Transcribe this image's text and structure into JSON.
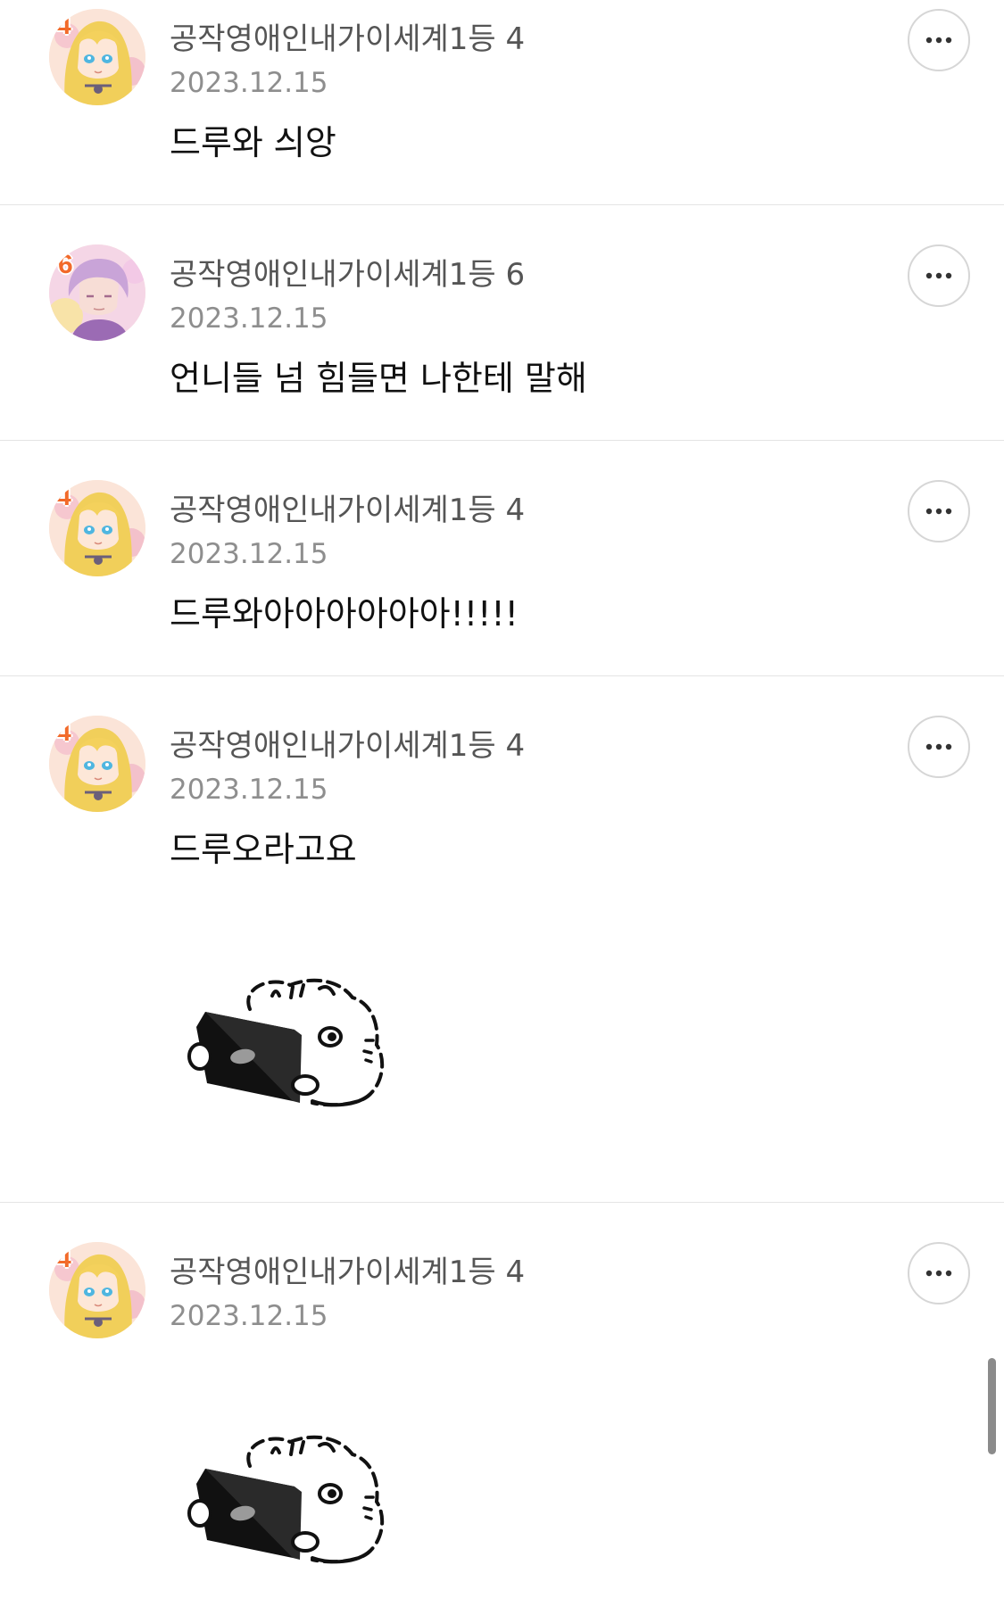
{
  "comments": [
    {
      "author": "공작영애인내가이세계1등 4",
      "avatar_badge": "4",
      "avatar_icon": "blonde-girl-avatar-icon",
      "date": "2023.12.15",
      "text": "드루와 싀앙",
      "more_icon": "more-horizontal-icon"
    },
    {
      "author": "공작영애인내가이세계1등 6",
      "avatar_badge": "6",
      "avatar_icon": "pink-boy-avatar-icon",
      "date": "2023.12.15",
      "text": "언니들 넘 힘들면 나한테 말해",
      "more_icon": "more-horizontal-icon"
    },
    {
      "author": "공작영애인내가이세계1등 4",
      "avatar_badge": "4",
      "avatar_icon": "blonde-girl-avatar-icon",
      "date": "2023.12.15",
      "text": "드루와아아아아아아!!!!!",
      "more_icon": "more-horizontal-icon"
    },
    {
      "author": "공작영애인내가이세계1등 4",
      "avatar_badge": "4",
      "avatar_icon": "blonde-girl-avatar-icon",
      "date": "2023.12.15",
      "text": "드루오라고요",
      "sticker": "fluffy-creature-holding-tablet-sticker",
      "more_icon": "more-horizontal-icon"
    },
    {
      "author": "공작영애인내가이세계1등 4",
      "avatar_badge": "4",
      "avatar_icon": "blonde-girl-avatar-icon",
      "date": "2023.12.15",
      "sticker": "fluffy-creature-holding-tablet-sticker",
      "more_icon": "more-horizontal-icon"
    }
  ],
  "colors": {
    "author_text": "#555555",
    "date_text": "#8e8e8e",
    "body_text": "#111111",
    "divider": "#e4e4e4",
    "badge_orange": "#f26a2a"
  }
}
